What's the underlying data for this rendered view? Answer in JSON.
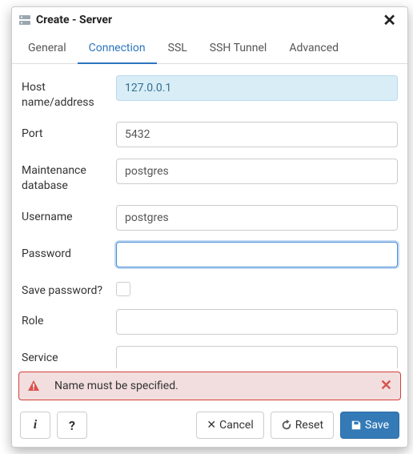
{
  "dialog": {
    "title": "Create - Server"
  },
  "tabs": {
    "general": "General",
    "connection": "Connection",
    "ssl": "SSL",
    "ssh_tunnel": "SSH Tunnel",
    "advanced": "Advanced",
    "active": "connection"
  },
  "labels": {
    "host": "Host name/address",
    "port": "Port",
    "maintenance_db": "Maintenance database",
    "username": "Username",
    "password": "Password",
    "save_password": "Save password?",
    "role": "Role",
    "service": "Service"
  },
  "values": {
    "host": "127.0.0.1",
    "port": "5432",
    "maintenance_db": "postgres",
    "username": "postgres",
    "password": "",
    "save_password": false,
    "role": "",
    "service": ""
  },
  "error": {
    "message": "Name must be specified."
  },
  "footer": {
    "info": "i",
    "help": "?",
    "cancel": "Cancel",
    "reset": "Reset",
    "save": "Save"
  }
}
